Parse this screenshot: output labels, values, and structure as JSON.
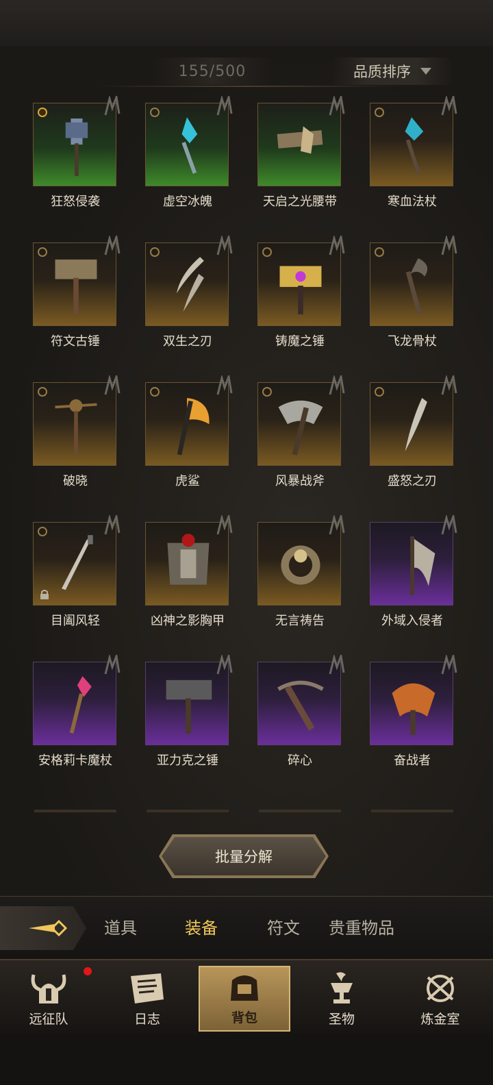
{
  "header": {
    "capacity": "155/500",
    "sort_label": "品质排序"
  },
  "items": [
    {
      "name": "狂怒侵袭",
      "rarity": "green",
      "icon": "storm-hammer-icon"
    },
    {
      "name": "虚空冰魄",
      "rarity": "green",
      "icon": "ice-scepter-icon"
    },
    {
      "name": "天启之光腰带",
      "rarity": "green",
      "icon": "belt-icon"
    },
    {
      "name": "寒血法杖",
      "rarity": "gold",
      "icon": "staff-icon"
    },
    {
      "name": "符文古锤",
      "rarity": "gold",
      "icon": "hammer-icon"
    },
    {
      "name": "双生之刃",
      "rarity": "gold",
      "icon": "twin-blades-icon"
    },
    {
      "name": "铸魔之锤",
      "rarity": "gold",
      "icon": "forge-hammer-icon"
    },
    {
      "name": "飞龙骨杖",
      "rarity": "gold",
      "icon": "bone-staff-icon"
    },
    {
      "name": "破晓",
      "rarity": "gold",
      "icon": "scepter-icon"
    },
    {
      "name": "虎鲨",
      "rarity": "gold",
      "icon": "flame-axe-icon"
    },
    {
      "name": "风暴战斧",
      "rarity": "gold",
      "icon": "battle-axe-icon"
    },
    {
      "name": "盛怒之刃",
      "rarity": "gold",
      "icon": "curved-blade-icon"
    },
    {
      "name": "目阖风轻",
      "rarity": "gold",
      "icon": "sword-icon"
    },
    {
      "name": "凶神之影胸甲",
      "rarity": "gold",
      "icon": "chest-armor-icon"
    },
    {
      "name": "无言祷告",
      "rarity": "gold",
      "icon": "ring-icon"
    },
    {
      "name": "外域入侵者",
      "rarity": "purple",
      "icon": "halberd-axe-icon"
    },
    {
      "name": "安格莉卡魔杖",
      "rarity": "purple",
      "icon": "crystal-staff-icon"
    },
    {
      "name": "亚力克之锤",
      "rarity": "purple",
      "icon": "spiked-hammer-icon"
    },
    {
      "name": "碎心",
      "rarity": "purple",
      "icon": "crossbow-icon"
    },
    {
      "name": "奋战者",
      "rarity": "purple",
      "icon": "great-axe-icon"
    }
  ],
  "batch_button": "批量分解",
  "tabs": [
    "道具",
    "装备",
    "符文",
    "贵重物品"
  ],
  "active_tab": "装备",
  "nav": [
    "远征队",
    "日志",
    "背包",
    "圣物",
    "炼金室"
  ],
  "active_nav": "背包",
  "colors": {
    "gold_tile": "#7a5a22",
    "purple_tile": "#6a2f9a",
    "green_tile": "#3f8a2a",
    "active_tab": "#f0c75a",
    "notification": "#e01818"
  }
}
